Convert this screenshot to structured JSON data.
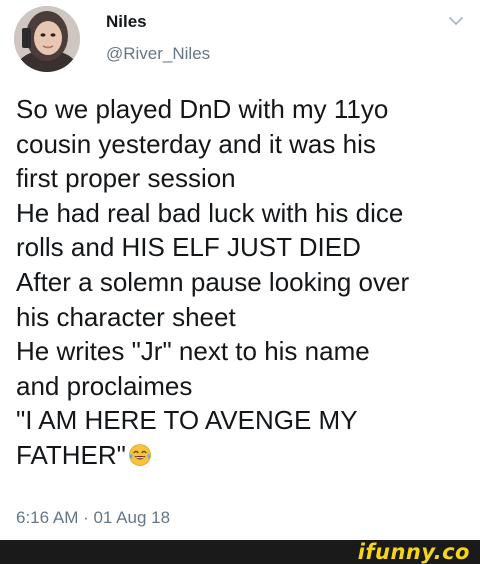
{
  "tweet": {
    "author_name": "Niles",
    "author_handle": "@River_Niles",
    "avatar_icon": "profile-photo-avatar",
    "menu_icon": "chevron-down-icon",
    "body_lines": [
      "So we played DnD with my 11yo",
      "cousin yesterday and it was his",
      "first proper session",
      "He had real bad luck with his dice",
      "rolls and HIS ELF JUST DIED",
      "After a solemn pause looking over",
      "his character sheet",
      "He writes \"Jr\" next to his name",
      "and proclaimes",
      "\"I AM HERE TO AVENGE MY",
      "FATHER\""
    ],
    "emoji_icon": "tears-of-joy-emoji",
    "timestamp": "6:16 AM · 01 Aug 18"
  },
  "footer": {
    "watermark": "ifunny.co",
    "background": "#1a1a1a",
    "watermark_color": "#f6d518"
  },
  "colors": {
    "text_primary": "#14171a",
    "text_secondary": "#657786"
  }
}
